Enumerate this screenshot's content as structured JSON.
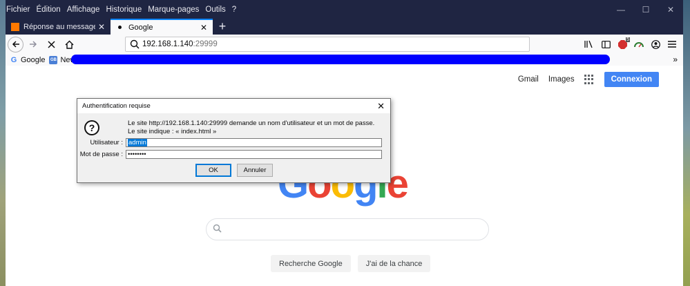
{
  "menu": [
    "Fichier",
    "Édition",
    "Affichage",
    "Historique",
    "Marque-pages",
    "Outils",
    "?"
  ],
  "window_controls": {
    "minimize": "—",
    "maximize": "☐",
    "close": "✕"
  },
  "tabs": [
    {
      "label": "Réponse au message - Comm",
      "active": false,
      "close": "✕"
    },
    {
      "label": "Google",
      "active": true,
      "close": "✕"
    }
  ],
  "new_tab_label": "+",
  "url": {
    "host": "192.168.1.140",
    "port": ":29999"
  },
  "toolbar": {
    "badge": "5"
  },
  "bookmarks": [
    {
      "label": "Google",
      "icon": "G"
    },
    {
      "label": "News",
      "icon": "GB"
    }
  ],
  "google": {
    "links": [
      "Gmail",
      "Images"
    ],
    "signin": "Connexion",
    "buttons": [
      "Recherche Google",
      "J'ai de la chance"
    ],
    "logo_visible": "Google"
  },
  "dialog": {
    "title": "Authentification requise",
    "message": "Le site http://192.168.1.140:29999 demande un nom d'utilisateur et un mot de passe. Le site indique : « index.html »",
    "user_label": "Utilisateur :",
    "user_value": "admin",
    "pass_label": "Mot de passe :",
    "pass_value": "••••••••",
    "ok": "OK",
    "cancel": "Annuler"
  },
  "colors": {
    "accent": "#0a84ff",
    "google_blue": "#4285f4",
    "redaction": "#0000ff"
  }
}
